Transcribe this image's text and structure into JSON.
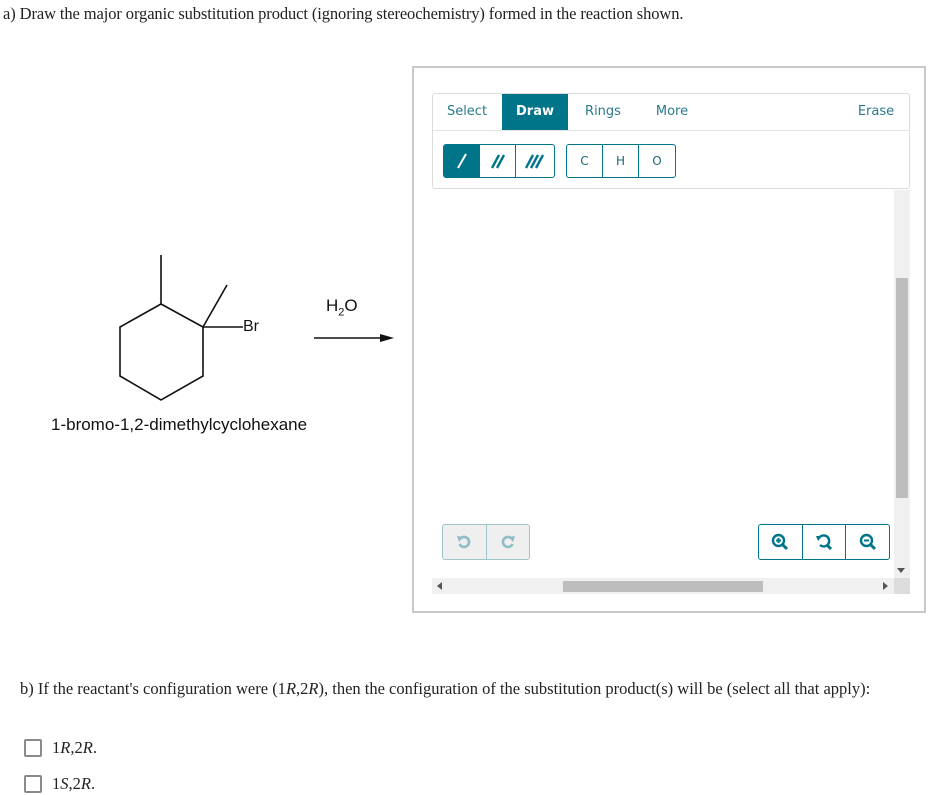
{
  "question_a": {
    "text": "a) Draw the major organic substitution product (ignoring stereochemistry) formed in the reaction shown."
  },
  "reaction": {
    "substituent_label": "Br",
    "reagent_main": "H",
    "reagent_sub": "2",
    "reagent_tail": "O",
    "reactant_name": "1-bromo-1,2-dimethylcyclohexane"
  },
  "editor": {
    "tabs": [
      {
        "label": "Select",
        "active": false
      },
      {
        "label": "Draw",
        "active": true
      },
      {
        "label": "Rings",
        "active": false
      },
      {
        "label": "More",
        "active": false
      },
      {
        "label": "Erase",
        "active": false
      }
    ],
    "bond_tools": [
      {
        "icon": "single-bond-icon",
        "active": true
      },
      {
        "icon": "double-bond-icon",
        "active": false
      },
      {
        "icon": "triple-bond-icon",
        "active": false
      }
    ],
    "atom_tools": [
      "C",
      "H",
      "O"
    ],
    "history_tools": [
      "undo-icon",
      "redo-icon"
    ],
    "zoom_tools": [
      "zoom-in-icon",
      "zoom-reset-icon",
      "zoom-out-icon"
    ],
    "accent_color": "#00758a"
  },
  "question_b": {
    "prefix": "b) If the reactant's configuration were (1",
    "r1": "R",
    "mid": ",2",
    "r2": "R",
    "suffix": "), then the configuration of the substitution product(s) will be (select all that apply):",
    "options": [
      {
        "n1": "1",
        "c1": "R",
        "n2": ",2",
        "c2": "R",
        "end": ".",
        "checked": false
      },
      {
        "n1": "1",
        "c1": "S",
        "n2": ",2",
        "c2": "R",
        "end": ".",
        "checked": false
      }
    ]
  }
}
